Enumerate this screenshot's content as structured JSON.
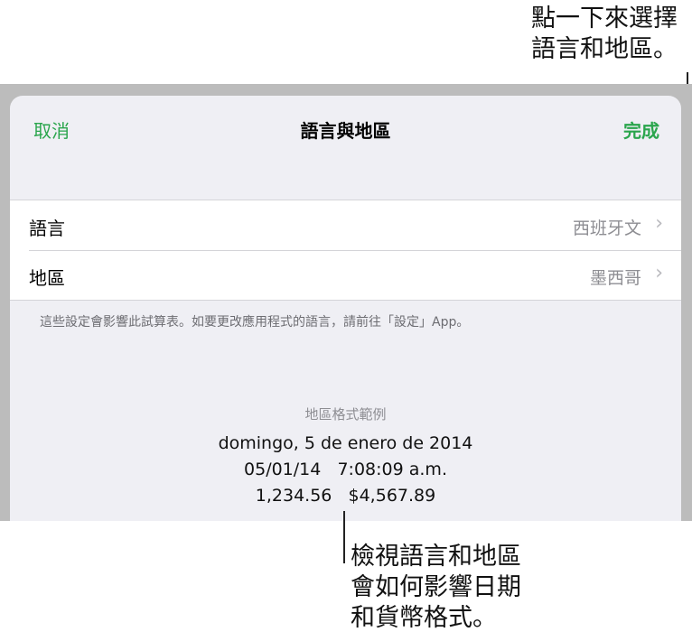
{
  "callouts": {
    "top": "點一下來選擇\n語言和地區。",
    "bottom": "檢視語言和地區\n會如何影響日期\n和貨幣格式。"
  },
  "nav": {
    "cancel_label": "取消",
    "title": "語言與地區",
    "done_label": "完成"
  },
  "settings": [
    {
      "label": "語言",
      "value": "西班牙文"
    },
    {
      "label": "地區",
      "value": "墨西哥"
    }
  ],
  "footnote": "這些設定會影響此試算表。如要更改應用程式的語言，請前往「設定」App。",
  "example": {
    "title": "地區格式範例",
    "date": "domingo, 5 de enero de 2014",
    "datetime": "05/01/14   7:08:09 a.m.",
    "numbers": "1,234.56   $4,567.89"
  },
  "colors": {
    "accent": "#2aa54c",
    "secondary_text": "#8e8e93",
    "background": "#efeff4"
  },
  "icons": {
    "disclosure": "chevron-right-icon"
  }
}
